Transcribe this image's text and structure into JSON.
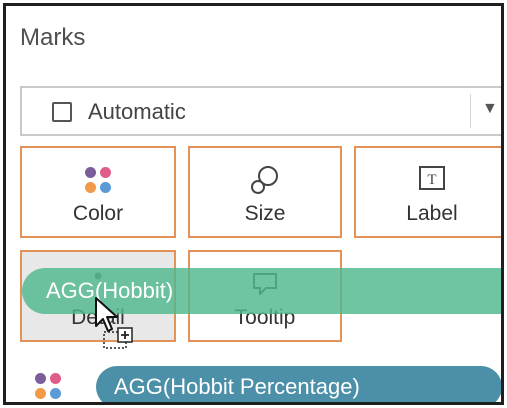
{
  "marks": {
    "title": "Marks",
    "mark_type": {
      "selected": "Automatic"
    },
    "cards": {
      "color": "Color",
      "size": "Size",
      "label": "Label",
      "label_icon_glyph": "T",
      "detail": "Detail",
      "tooltip": "Tooltip"
    },
    "dragged_pill": "AGG(Hobbit)",
    "field_pill": "AGG(Hobbit Percentage)"
  },
  "colors": {
    "card_border": "#e3935a",
    "dragged_pill": "#4fb78d",
    "field_pill": "#4b90a8",
    "dots": [
      "#7b5d9b",
      "#e05c8a",
      "#f29a48",
      "#5b9bd5"
    ]
  },
  "icons": [
    "square-icon",
    "chevron-down-icon",
    "color-dots-icon",
    "size-icon",
    "label-icon",
    "detail-icon",
    "tooltip-icon",
    "drag-cursor-icon"
  ]
}
